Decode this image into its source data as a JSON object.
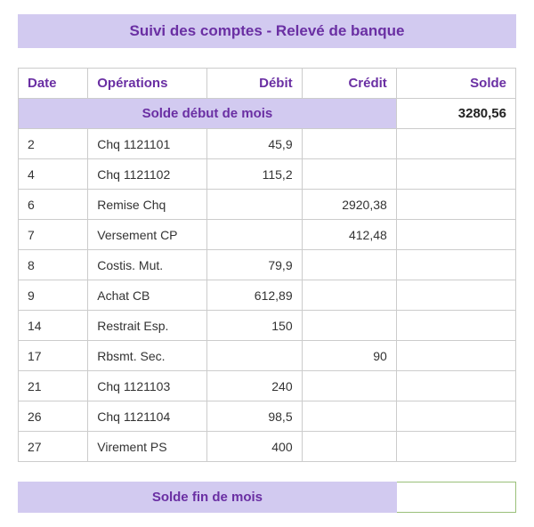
{
  "title": "Suivi des comptes - Relevé de banque",
  "headers": {
    "date": "Date",
    "operations": "Opérations",
    "debit": "Débit",
    "credit": "Crédit",
    "solde": "Solde"
  },
  "start_row": {
    "label": "Solde début de mois",
    "value": "3280,56"
  },
  "rows": [
    {
      "date": "2",
      "op": "Chq 1121101",
      "debit": "45,9",
      "credit": "",
      "solde": ""
    },
    {
      "date": "4",
      "op": "Chq 1121102",
      "debit": "115,2",
      "credit": "",
      "solde": ""
    },
    {
      "date": "6",
      "op": "Remise Chq",
      "debit": "",
      "credit": "2920,38",
      "solde": ""
    },
    {
      "date": "7",
      "op": "Versement CP",
      "debit": "",
      "credit": "412,48",
      "solde": ""
    },
    {
      "date": "8",
      "op": "Costis. Mut.",
      "debit": "79,9",
      "credit": "",
      "solde": ""
    },
    {
      "date": "9",
      "op": "Achat CB",
      "debit": "612,89",
      "credit": "",
      "solde": ""
    },
    {
      "date": "14",
      "op": "Restrait Esp.",
      "debit": "150",
      "credit": "",
      "solde": ""
    },
    {
      "date": "17",
      "op": "Rbsmt. Sec.",
      "debit": "",
      "credit": "90",
      "solde": ""
    },
    {
      "date": "21",
      "op": "Chq 1121103",
      "debit": "240",
      "credit": "",
      "solde": ""
    },
    {
      "date": "26",
      "op": "Chq 1121104",
      "debit": "98,5",
      "credit": "",
      "solde": ""
    },
    {
      "date": "27",
      "op": "Virement PS",
      "debit": "400",
      "credit": "",
      "solde": ""
    }
  ],
  "end_row": {
    "label": "Solde fin de mois",
    "value": ""
  },
  "chart_data": {
    "type": "table",
    "title": "Suivi des comptes - Relevé de banque",
    "columns": [
      "Date",
      "Opérations",
      "Débit",
      "Crédit",
      "Solde"
    ],
    "opening_balance": 3280.56,
    "rows": [
      {
        "date": 2,
        "operation": "Chq 1121101",
        "debit": 45.9,
        "credit": null
      },
      {
        "date": 4,
        "operation": "Chq 1121102",
        "debit": 115.2,
        "credit": null
      },
      {
        "date": 6,
        "operation": "Remise Chq",
        "debit": null,
        "credit": 2920.38
      },
      {
        "date": 7,
        "operation": "Versement CP",
        "debit": null,
        "credit": 412.48
      },
      {
        "date": 8,
        "operation": "Costis. Mut.",
        "debit": 79.9,
        "credit": null
      },
      {
        "date": 9,
        "operation": "Achat CB",
        "debit": 612.89,
        "credit": null
      },
      {
        "date": 14,
        "operation": "Restrait Esp.",
        "debit": 150,
        "credit": null
      },
      {
        "date": 17,
        "operation": "Rbsmt. Sec.",
        "debit": null,
        "credit": 90
      },
      {
        "date": 21,
        "operation": "Chq 1121103",
        "debit": 240,
        "credit": null
      },
      {
        "date": 26,
        "operation": "Chq 1121104",
        "debit": 98.5,
        "credit": null
      },
      {
        "date": 27,
        "operation": "Virement PS",
        "debit": 400,
        "credit": null
      }
    ],
    "closing_balance": null
  }
}
